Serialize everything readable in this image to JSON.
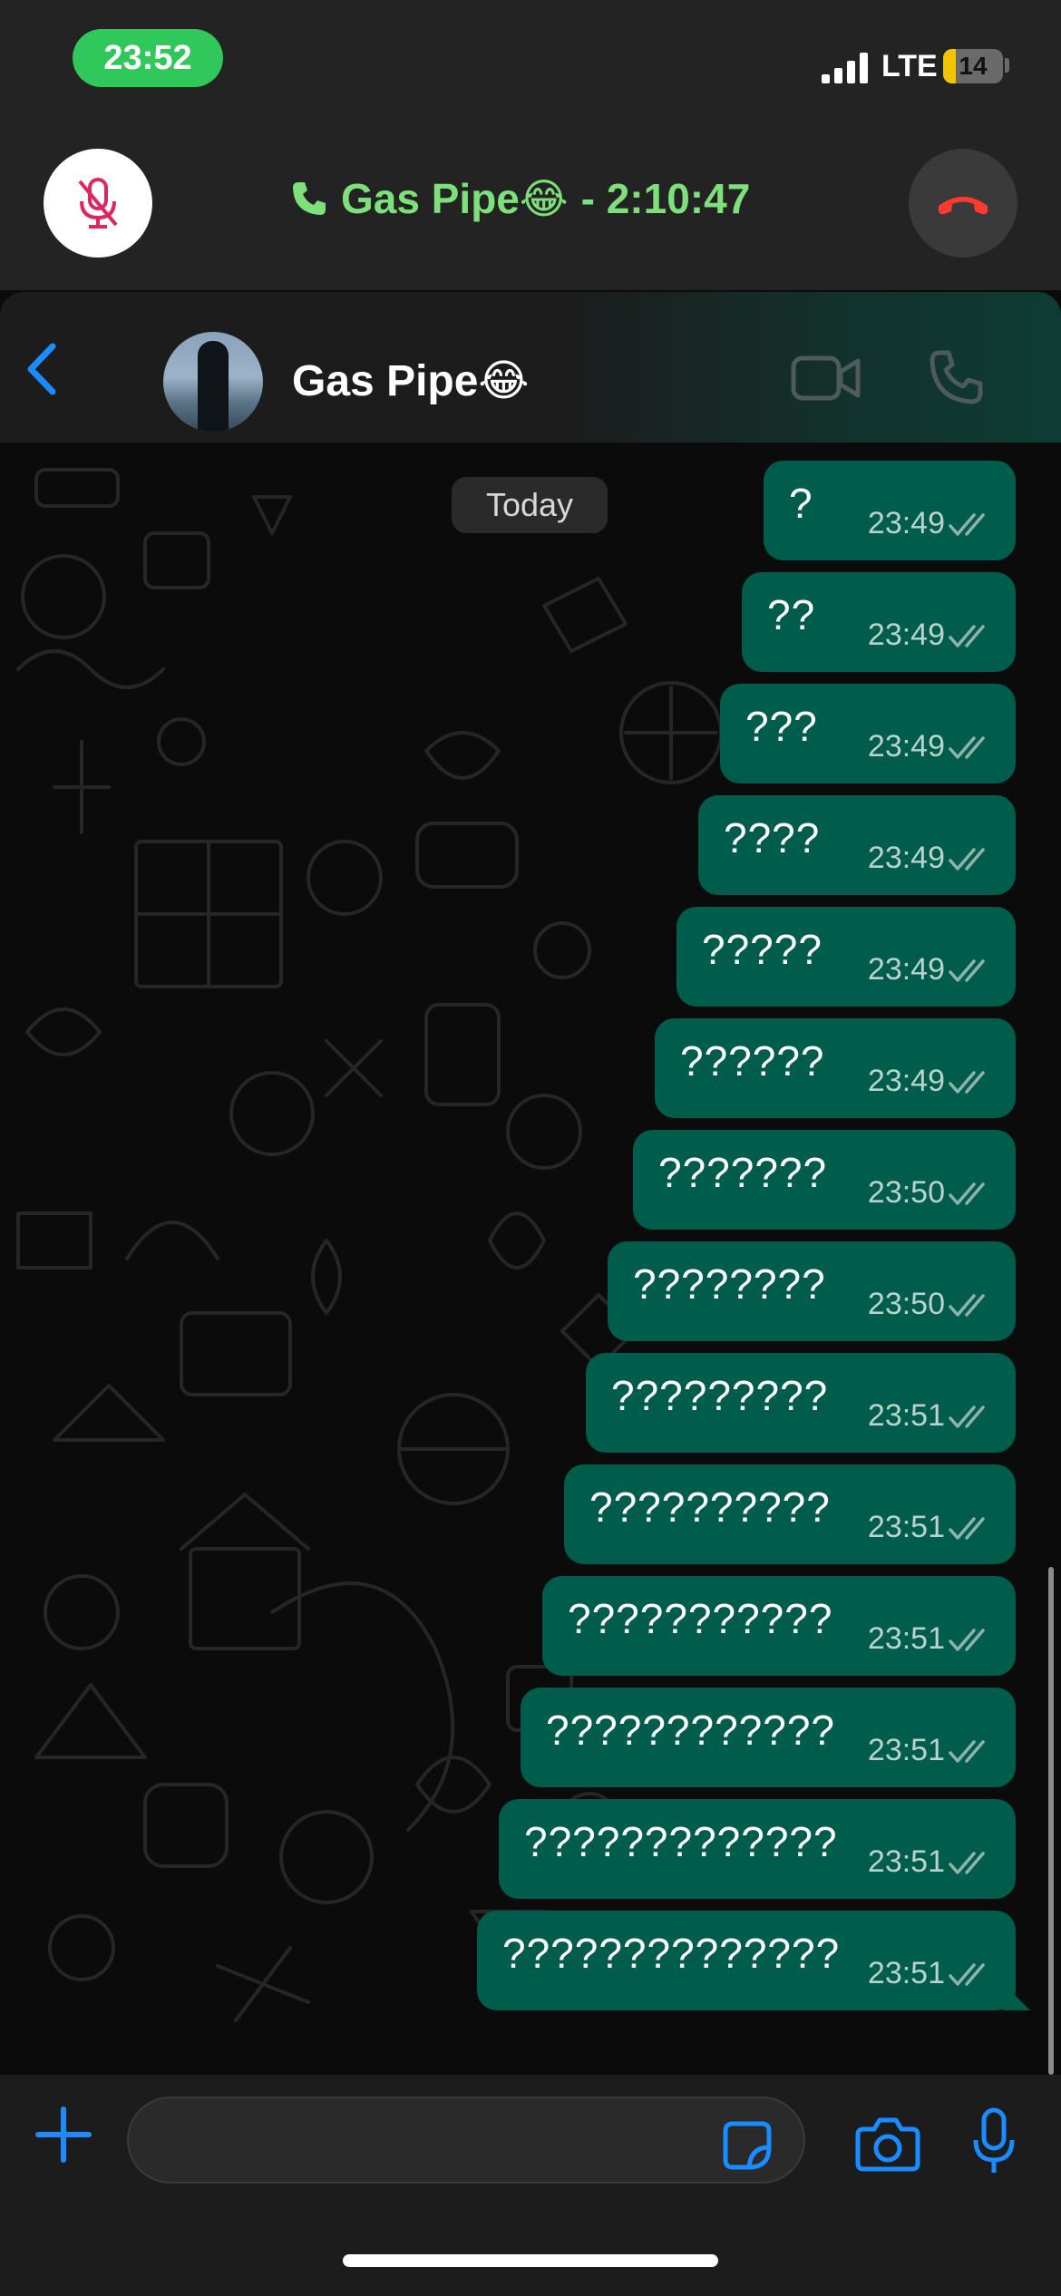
{
  "status_bar": {
    "time": "23:52",
    "network": "LTE",
    "battery": "14"
  },
  "call_bar": {
    "icon": "phone-icon",
    "name": "Gas Pipe😂",
    "duration_text": "- 2:10:47"
  },
  "chat_header": {
    "contact_name": "Gas Pipe😂"
  },
  "chat": {
    "date_label": "Today",
    "messages": [
      {
        "text": "?",
        "time": "23:49"
      },
      {
        "text": "??",
        "time": "23:49"
      },
      {
        "text": "???",
        "time": "23:49"
      },
      {
        "text": "????",
        "time": "23:49"
      },
      {
        "text": "?????",
        "time": "23:49"
      },
      {
        "text": "??????",
        "time": "23:49"
      },
      {
        "text": "???????",
        "time": "23:50"
      },
      {
        "text": "????????",
        "time": "23:50"
      },
      {
        "text": "?????????",
        "time": "23:51"
      },
      {
        "text": "??????????",
        "time": "23:51"
      },
      {
        "text": "???????????",
        "time": "23:51"
      },
      {
        "text": "????????????",
        "time": "23:51"
      },
      {
        "text": "?????????????",
        "time": "23:51"
      },
      {
        "text": "??????????????",
        "time": "23:51"
      }
    ]
  },
  "colors": {
    "bubble": "#005c4b",
    "accent_blue": "#1a8cff",
    "call_green": "#7de07a",
    "status_green": "#30c85a",
    "end_call_red": "#ff3b30"
  }
}
